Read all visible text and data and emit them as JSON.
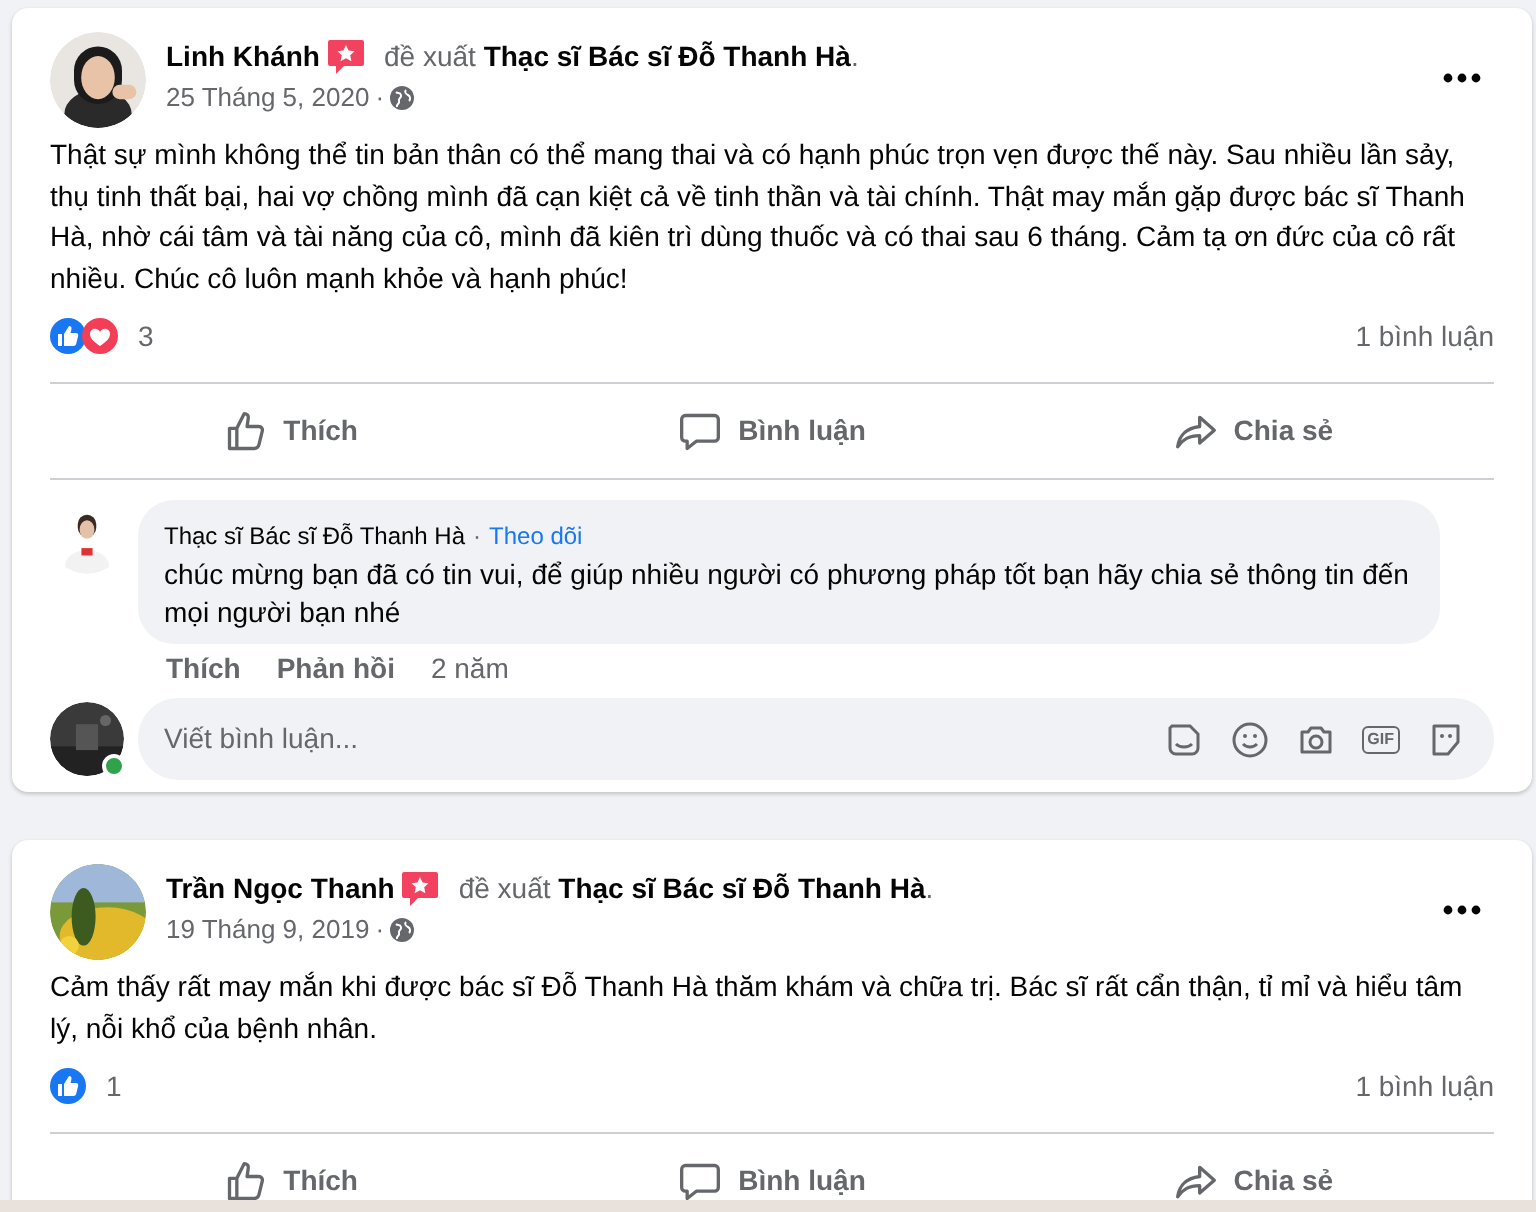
{
  "posts": [
    {
      "author": "Linh Khánh",
      "recommendation": "đề xuất **Thạc sĩ Bác sĩ Đỗ Thanh Hà**.",
      "date": "25 Tháng 5, 2020",
      "date_separator": "·",
      "text": "Thật sự mình không thể tin bản thân có thể mang thai và có hạnh phúc trọn vẹn được thế này. Sau nhiều lần sảy, thụ tinh thất bại, hai vợ chồng mình đã cạn kiệt cả về tinh thần và tài chính. Thật may mắn gặp được bác sĩ Thanh Hà, nhờ cái tâm và tài năng của cô, mình đã kiên trì dùng thuốc và có thai sau 6 tháng. Cảm tạ ơn đức của cô rất nhiều. Chúc cô luôn mạnh khỏe và hạnh phúc!",
      "reactions": [
        {
          "kind": "like"
        },
        {
          "kind": "love"
        }
      ],
      "reaction_count": "3",
      "comment_count": "1 bình luận",
      "actions": [
        {
          "kind": "like",
          "label": "Thích"
        },
        {
          "kind": "comment",
          "label": "Bình luận"
        },
        {
          "kind": "share",
          "label": "Chia sẻ"
        }
      ],
      "comments": [
        {
          "author": "Thạc sĩ Bác sĩ Đỗ Thanh Hà",
          "separator": "·",
          "follow": "Theo dõi",
          "text": "chúc mừng bạn đã có tin vui, để giúp nhiều người có phương pháp tốt bạn hãy chia sẻ thông tin đến mọi người bạn nhé",
          "actions": [
            "Thích",
            "Phản hồi"
          ],
          "time": "2 năm"
        }
      ],
      "composer": {
        "placeholder": "Viết bình luận...",
        "online": true,
        "tools": [
          {
            "kind": "sticker-face"
          },
          {
            "kind": "emoji"
          },
          {
            "kind": "camera"
          },
          {
            "kind": "gif",
            "label": "GIF"
          },
          {
            "kind": "sticker"
          }
        ]
      }
    },
    {
      "author": "Trần Ngọc Thanh",
      "recommendation": "đề xuất **Thạc sĩ Bác sĩ Đỗ Thanh Hà**.",
      "date": "19 Tháng 9, 2019",
      "date_separator": "·",
      "text": "Cảm thấy rất may mắn khi được bác sĩ Đỗ Thanh Hà thăm khám và chữa trị. Bác sĩ rất cẩn thận, tỉ mỉ và hiểu tâm lý, nỗi khổ của bệnh nhân.",
      "reactions": [
        {
          "kind": "like"
        }
      ],
      "reaction_count": "1",
      "comment_count": "1 bình luận",
      "actions": [
        {
          "kind": "like",
          "label": "Thích"
        },
        {
          "kind": "comment",
          "label": "Bình luận"
        },
        {
          "kind": "share",
          "label": "Chia sẻ"
        }
      ]
    }
  ]
}
